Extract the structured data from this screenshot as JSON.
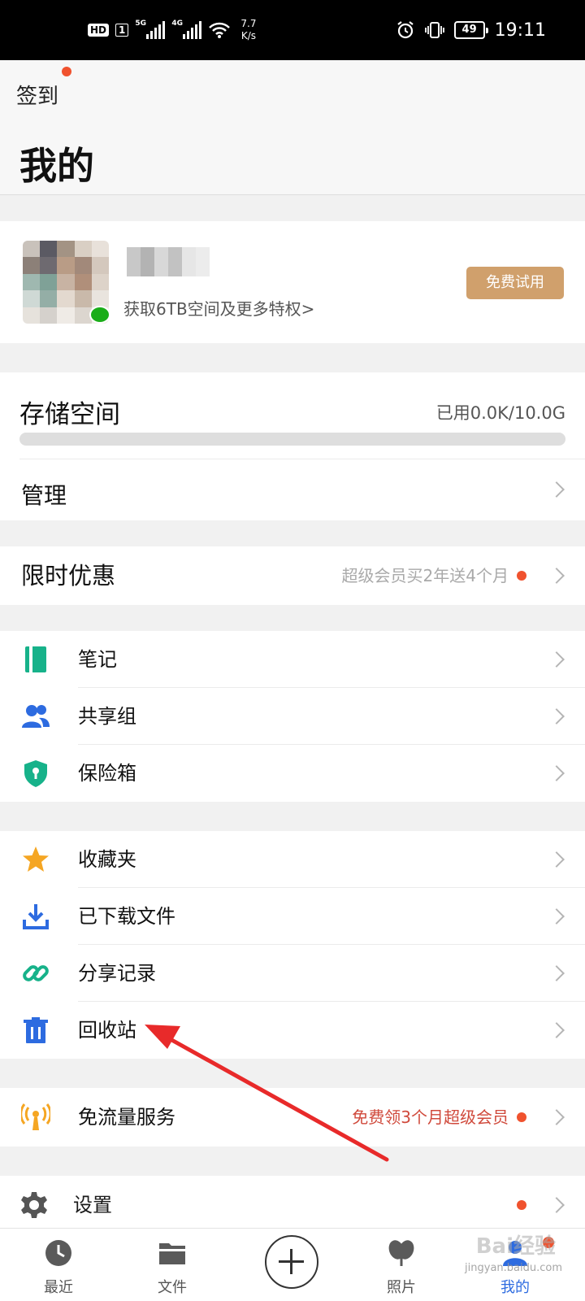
{
  "status_bar": {
    "hd": "HD",
    "sim": "1",
    "net1": "5G",
    "net2": "4G",
    "speed_value": "7.7",
    "speed_unit": "K/s",
    "battery": "49",
    "time": "19:11"
  },
  "header": {
    "checkin_label": "签到",
    "title": "我的"
  },
  "profile": {
    "promo_text": "获取6TB空间及更多特权>",
    "trial_label": "免费试用"
  },
  "storage": {
    "title": "存储空间",
    "used_text": "已用0.0K/10.0G",
    "used_fraction": 0.0,
    "manage_label": "管理"
  },
  "limited_offer": {
    "title": "限时优惠",
    "desc": "超级会员买2年送4个月"
  },
  "group1": [
    {
      "label": "笔记",
      "icon": "note-icon"
    },
    {
      "label": "共享组",
      "icon": "share-group-icon"
    },
    {
      "label": "保险箱",
      "icon": "safe-icon"
    }
  ],
  "group2": [
    {
      "label": "收藏夹",
      "icon": "star-icon"
    },
    {
      "label": "已下载文件",
      "icon": "download-icon"
    },
    {
      "label": "分享记录",
      "icon": "link-icon"
    },
    {
      "label": "回收站",
      "icon": "trash-icon"
    }
  ],
  "traffic": {
    "label": "免流量服务",
    "desc": "免费领3个月超级会员"
  },
  "settings": {
    "label": "设置"
  },
  "tabbar": {
    "recent": "最近",
    "files": "文件",
    "photos": "照片",
    "mine": "我的"
  },
  "watermark": {
    "logo": "Bai经验",
    "url": "jingyan.baidu.com"
  },
  "colors": {
    "accent_blue": "#2d6be0",
    "red_dot": "#f0522e",
    "trial_gold": "#d0a06c",
    "note_green": "#17b28a",
    "star_orange": "#f5a623"
  }
}
